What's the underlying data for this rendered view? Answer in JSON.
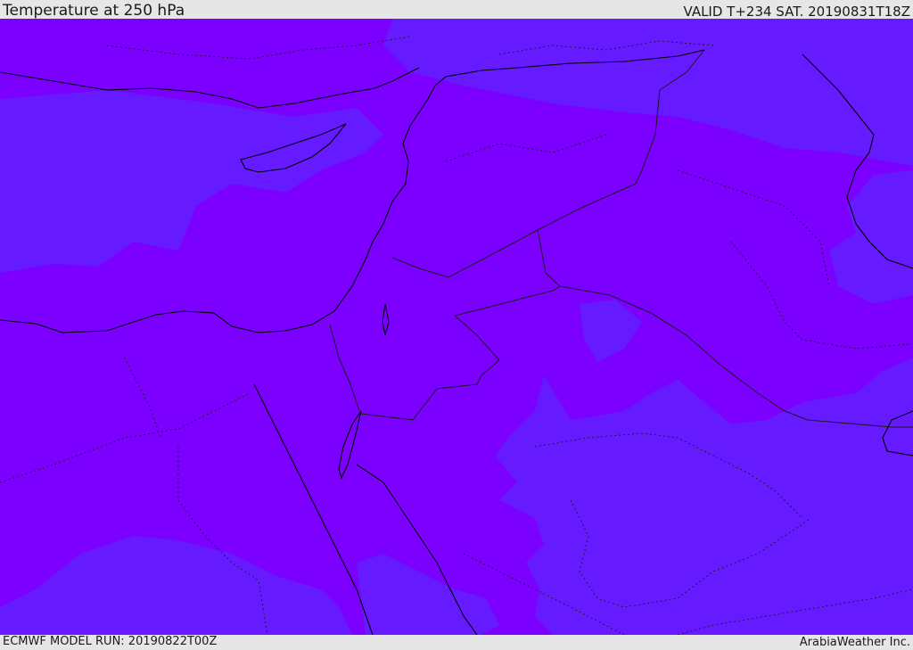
{
  "header": {
    "title": "Temperature at 250 hPa",
    "valid_time": "VALID T+234 SAT. 20190831T18Z"
  },
  "footer": {
    "model_run": "ECMWF MODEL RUN: 20190822T00Z",
    "credit": "ArabiaWeather Inc."
  },
  "map": {
    "colors": {
      "warmer_band": "#7b00ff",
      "cooler_band": "#661aff",
      "coastline": "#000000",
      "border": "#1a1a1a"
    }
  }
}
